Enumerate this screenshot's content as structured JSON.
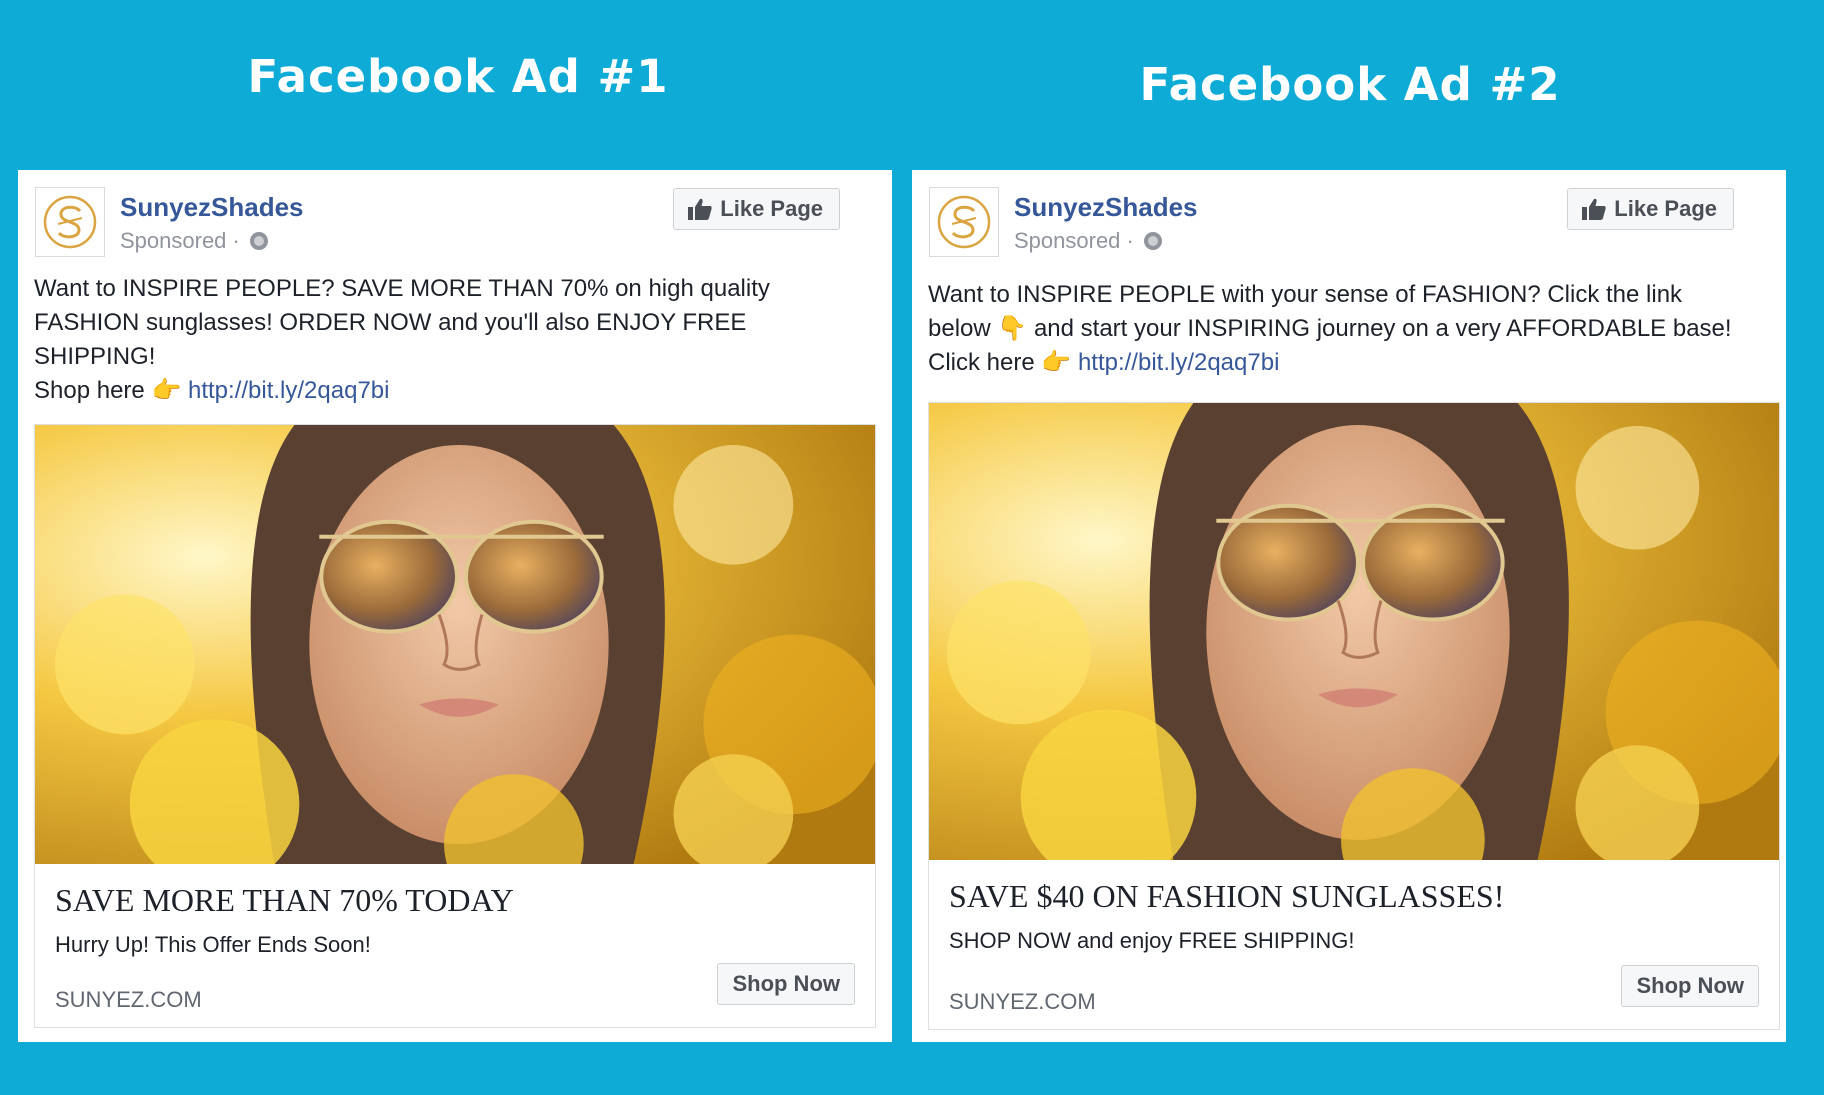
{
  "titles": [
    "Facebook Ad #1",
    "Facebook Ad #2"
  ],
  "brand": {
    "page_name": "SunyezShades",
    "sponsored": "Sponsored ·",
    "like_label": "Like Page",
    "logo_color": "#d9a441",
    "link_color": "#365899"
  },
  "ad1": {
    "text_line1": "Want to INSPIRE PEOPLE? SAVE MORE THAN 70% on high quality",
    "text_line2": "FASHION sunglasses! ORDER NOW and you'll also ENJOY FREE",
    "text_line3": "SHIPPING!",
    "shop_prefix": "Shop here",
    "link": "http://bit.ly/2qaq7bi",
    "headline": "SAVE MORE THAN 70% TODAY",
    "description": "Hurry Up! This Offer Ends Soon!",
    "domain": "SUNYEZ.COM",
    "cta": "Shop Now"
  },
  "ad2": {
    "text_line1": "Want to INSPIRE PEOPLE with your sense of FASHION? Click the link",
    "text_line2a": "below",
    "text_line2b": "and start your INSPIRING journey on a very AFFORDABLE base!",
    "click_prefix": "Click here",
    "link": "http://bit.ly/2qaq7bi",
    "headline": "SAVE $40 ON FASHION SUNGLASSES!",
    "description": "SHOP NOW and enjoy FREE SHIPPING!",
    "domain": "SUNYEZ.COM",
    "cta": "Shop Now"
  },
  "icons": {
    "pointing_right": "👉",
    "pointing_down": "👇",
    "thumbs_up": "thumbs-up-icon",
    "globe": "globe-icon"
  }
}
